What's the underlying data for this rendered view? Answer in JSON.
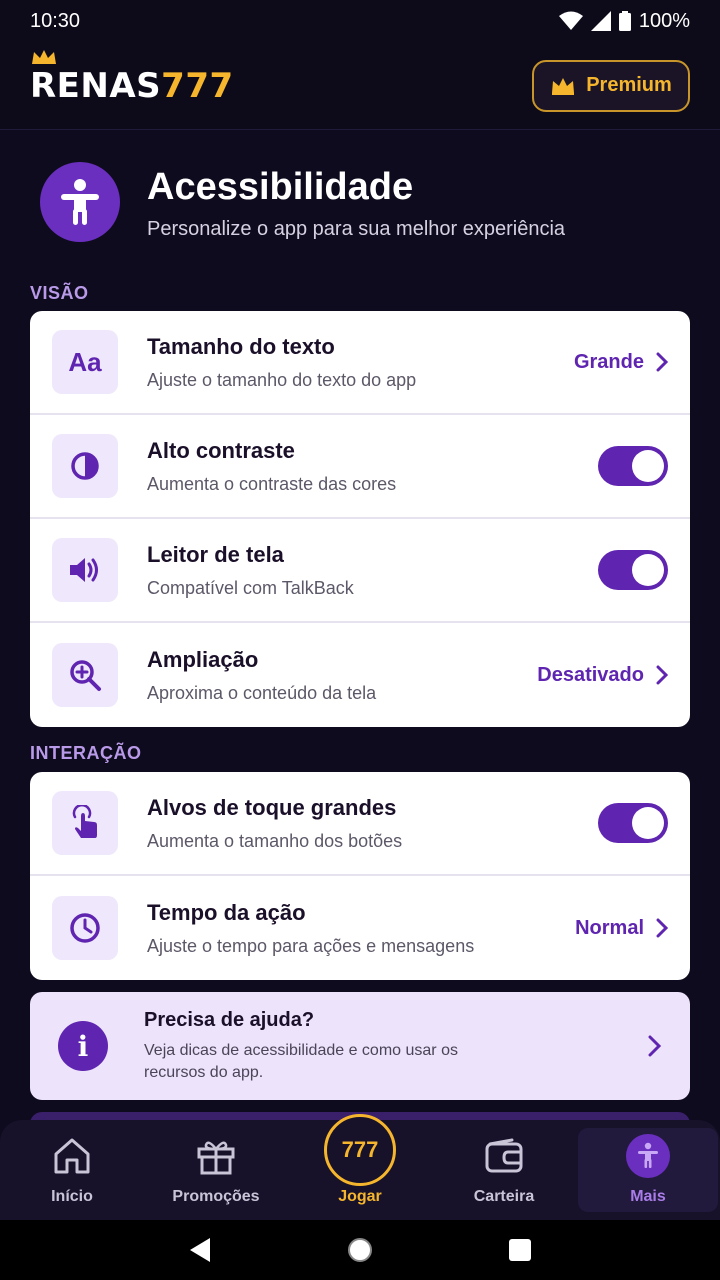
{
  "status_bar": {
    "time": "10:30",
    "battery": "100%"
  },
  "header": {
    "brand_part1": "RENAS",
    "brand_part2": "777",
    "premium_label": "Premium"
  },
  "page": {
    "title": "Acessibilidade",
    "subtitle": "Personalize o app para sua melhor experiência"
  },
  "sections": {
    "vision": {
      "label": "VISÃO",
      "items": [
        {
          "icon": "text-size-icon",
          "icon_text": "Aa",
          "title": "Tamanho do texto",
          "desc": "Ajuste o tamanho do texto do app",
          "value": "Grande"
        },
        {
          "icon": "contrast-icon",
          "title": "Alto contraste",
          "desc": "Aumenta o contraste das cores",
          "toggle": true
        },
        {
          "icon": "speaker-icon",
          "title": "Leitor de tela",
          "desc": "Compatível com TalkBack",
          "toggle": true
        },
        {
          "icon": "zoom-icon",
          "title": "Ampliação",
          "desc": "Aproxima o conteúdo da tela",
          "value": "Desativado"
        }
      ]
    },
    "interaction": {
      "label": "INTERAÇÃO",
      "items": [
        {
          "icon": "touch-icon",
          "title": "Alvos de toque grandes",
          "desc": "Aumenta o tamanho dos botões",
          "toggle": true
        },
        {
          "icon": "clock-icon",
          "title": "Tempo da ação",
          "desc": "Ajuste o tempo para ações e mensagens",
          "value": "Normal"
        }
      ]
    }
  },
  "help": {
    "icon_text": "i",
    "title": "Precisa de ajuda?",
    "desc": "Veja dicas de acessibilidade e como usar os recursos do app."
  },
  "bottom_nav": [
    {
      "label": "Início",
      "icon": "home-icon"
    },
    {
      "label": "Promoções",
      "icon": "gift-icon"
    },
    {
      "label": "Jogar",
      "icon": "play-777-icon",
      "badge": "777"
    },
    {
      "label": "Carteira",
      "icon": "wallet-icon"
    },
    {
      "label": "Mais",
      "icon": "accessibility-icon",
      "active": true
    }
  ],
  "colors": {
    "accent": "#5f25b0",
    "gold": "#f5b52d",
    "background": "#0f0b1e"
  }
}
